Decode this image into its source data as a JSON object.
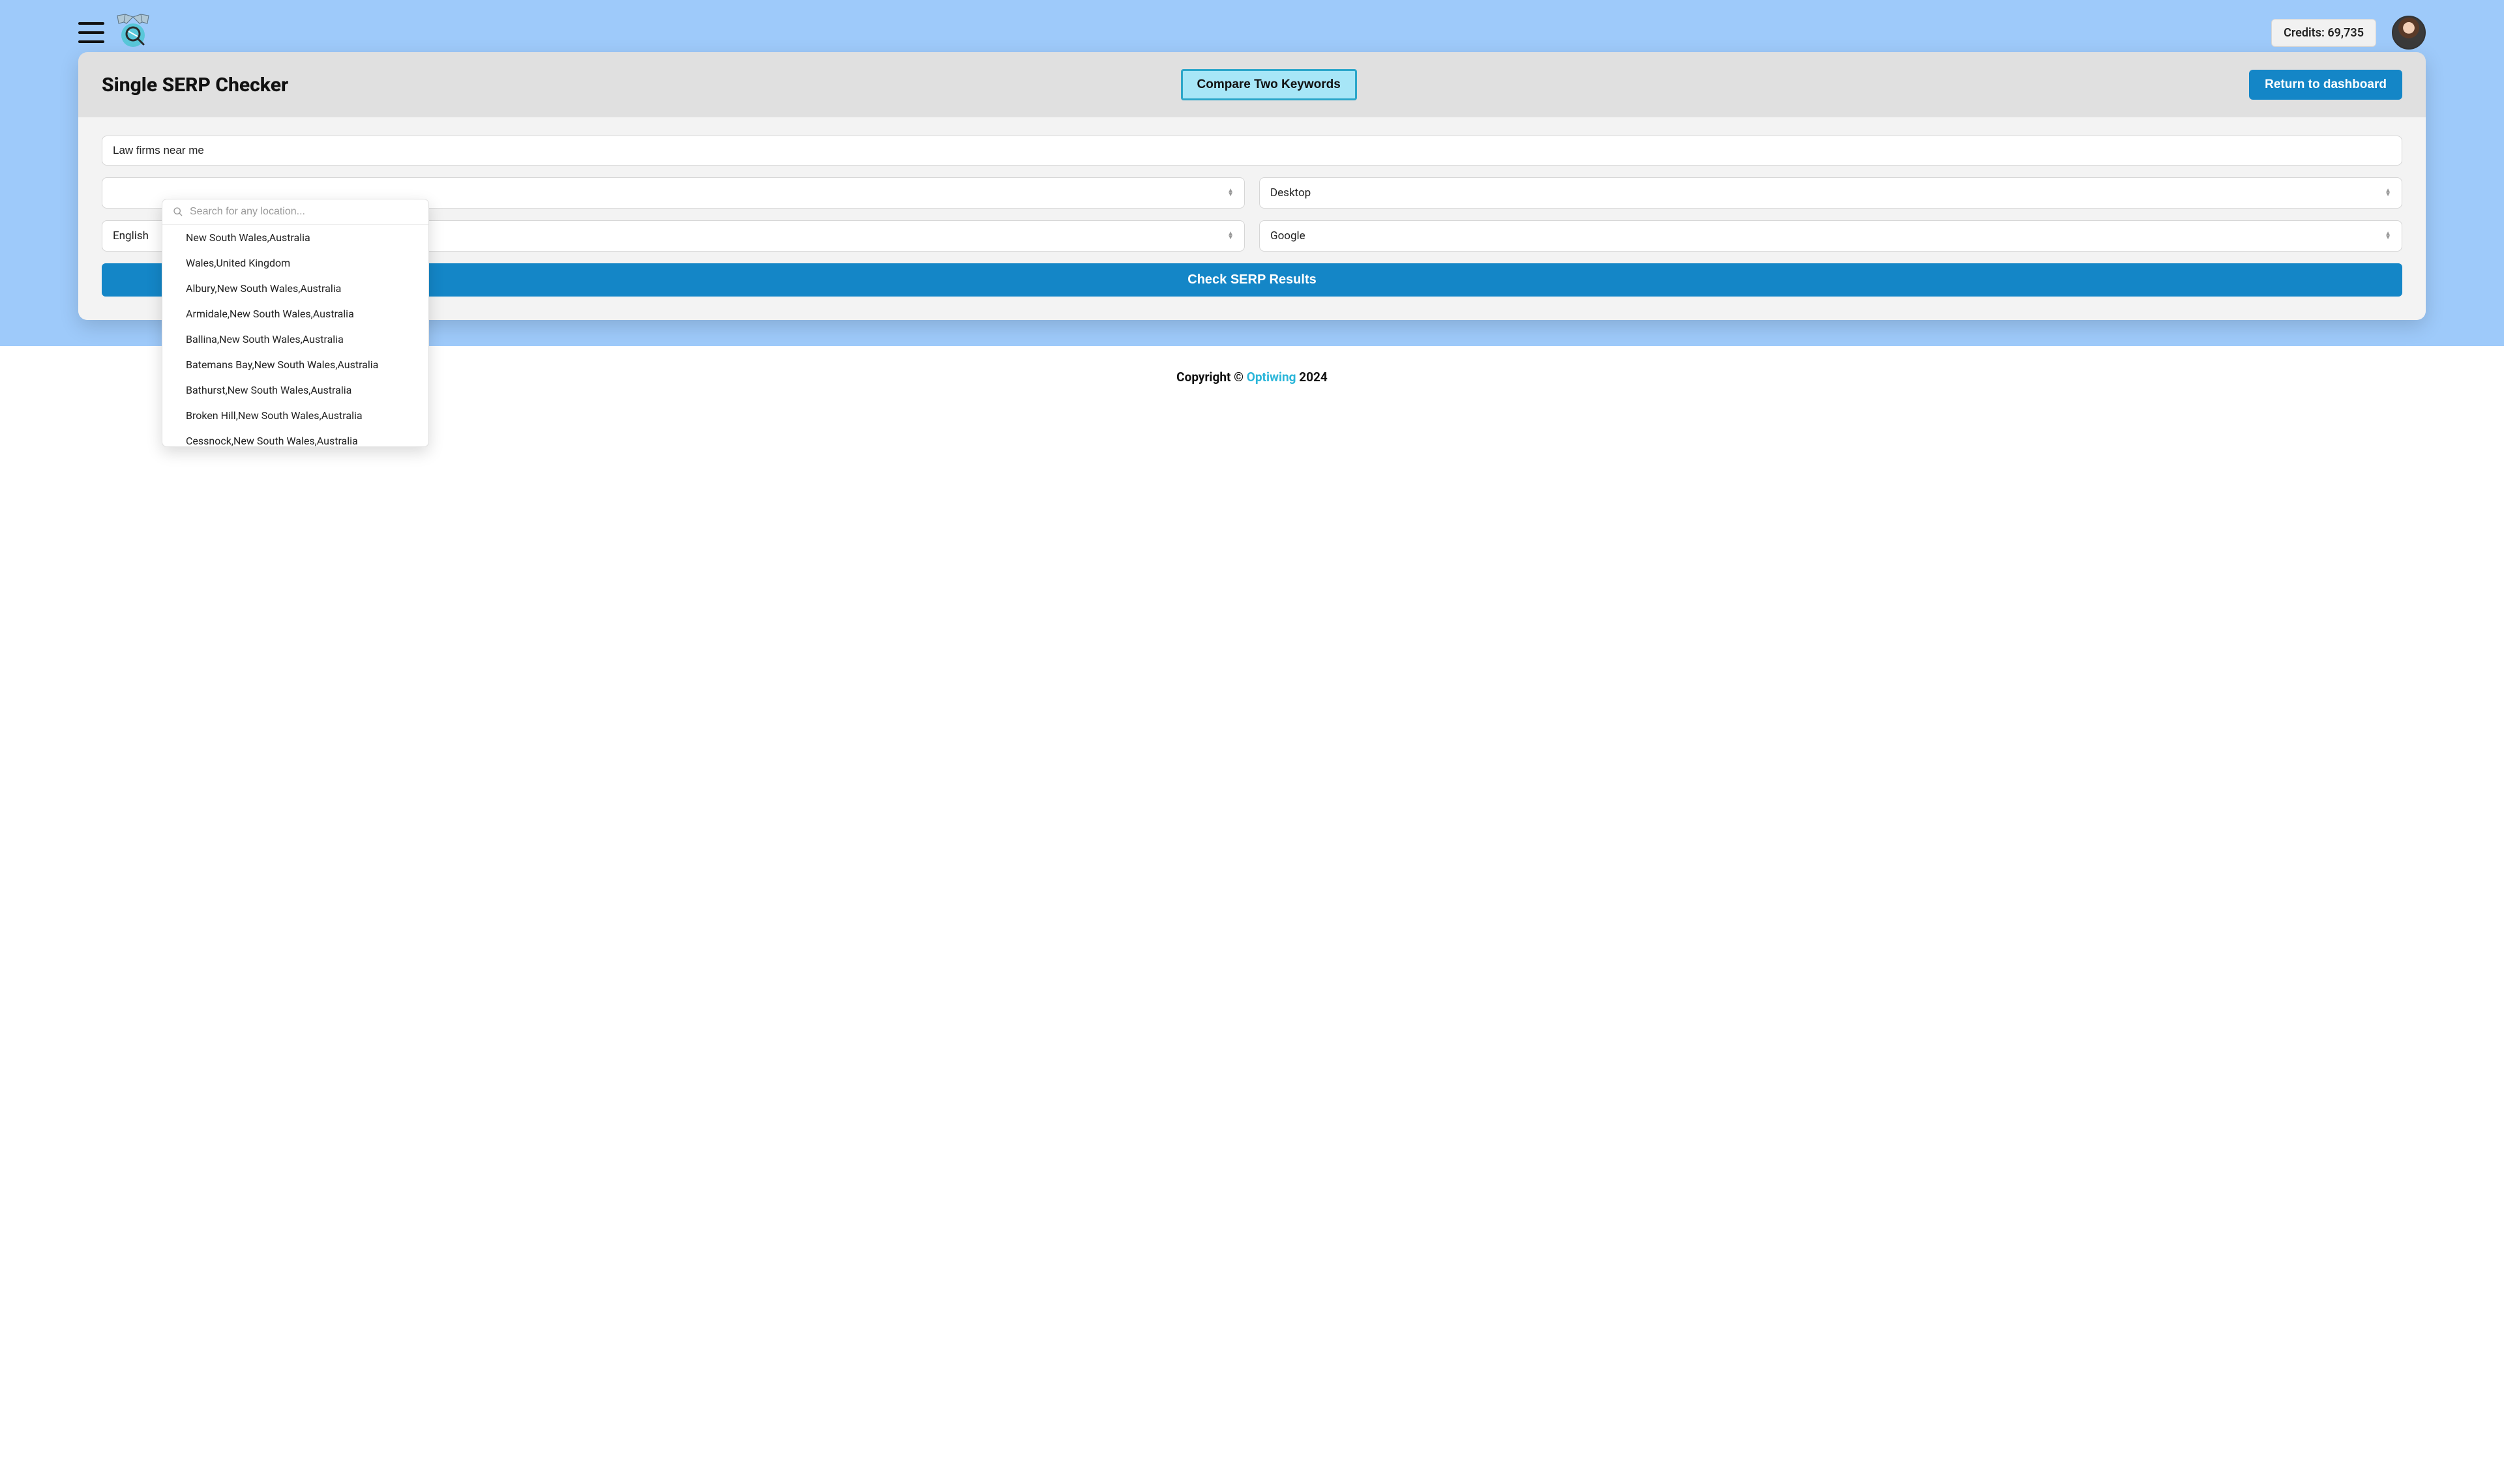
{
  "header": {
    "credits_label": "Credits: 69,735"
  },
  "page": {
    "title": "Single SERP Checker"
  },
  "buttons": {
    "compare": "Compare Two Keywords",
    "return": "Return to dashboard",
    "check": "Check SERP Results"
  },
  "form": {
    "keyword_value": "Law firms near me",
    "location_selected": "",
    "device_selected": "Desktop",
    "language_selected": "English",
    "engine_selected": "Google",
    "location_search_placeholder": "Search for any location..."
  },
  "location_options": [
    "New South Wales,Australia",
    "Wales,United Kingdom",
    "Albury,New South Wales,Australia",
    "Armidale,New South Wales,Australia",
    "Ballina,New South Wales,Australia",
    "Batemans Bay,New South Wales,Australia",
    "Bathurst,New South Wales,Australia",
    "Broken Hill,New South Wales,Australia",
    "Cessnock,New South Wales,Australia"
  ],
  "footer": {
    "prefix": "Copyright © ",
    "brand": "Optiwing",
    "suffix": " 2024"
  }
}
